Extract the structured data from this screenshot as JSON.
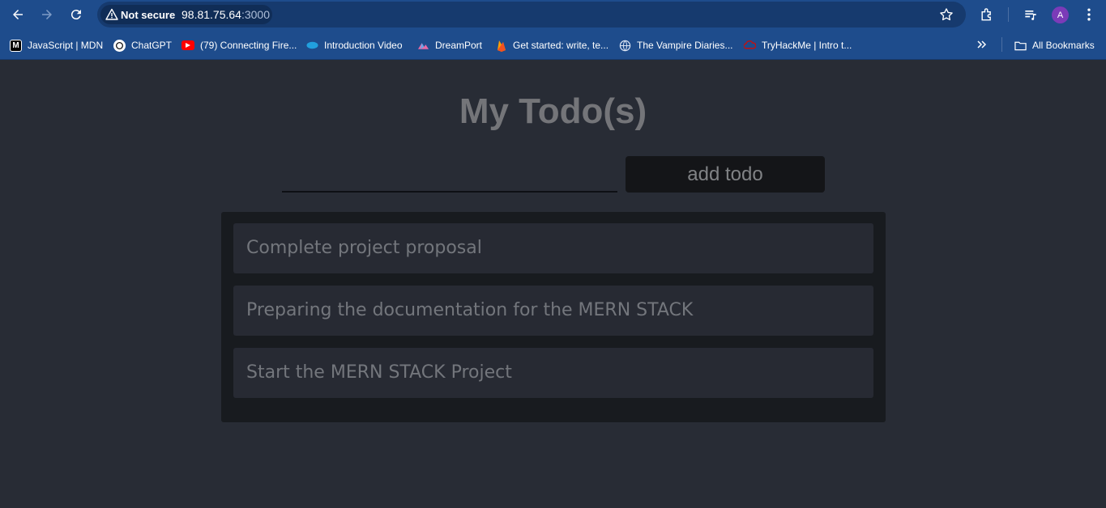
{
  "browser": {
    "security_label": "Not secure",
    "url_host": "98.81.75.64",
    "url_port": ":3000",
    "profile_initial": "A",
    "bookmarks": [
      {
        "label": "JavaScript | MDN",
        "icon": "mdn-icon"
      },
      {
        "label": "ChatGPT",
        "icon": "chatgpt-icon"
      },
      {
        "label": "(79) Connecting Fire...",
        "icon": "youtube-icon"
      },
      {
        "label": "Introduction Video",
        "icon": "salesforce-icon"
      },
      {
        "label": "DreamPort",
        "icon": "dreamport-icon"
      },
      {
        "label": "Get started: write, te...",
        "icon": "firebase-icon"
      },
      {
        "label": "The Vampire Diaries...",
        "icon": "globe-icon"
      },
      {
        "label": "TryHackMe | Intro t...",
        "icon": "tryhackme-icon"
      }
    ],
    "all_bookmarks_label": "All Bookmarks"
  },
  "app": {
    "title": "My Todo(s)",
    "input_value": "",
    "add_button_label": "add todo",
    "todos": [
      {
        "text": "Complete project proposal"
      },
      {
        "text": "Preparing the documentation for the MERN STACK"
      },
      {
        "text": "Start the MERN STACK Project"
      }
    ]
  }
}
